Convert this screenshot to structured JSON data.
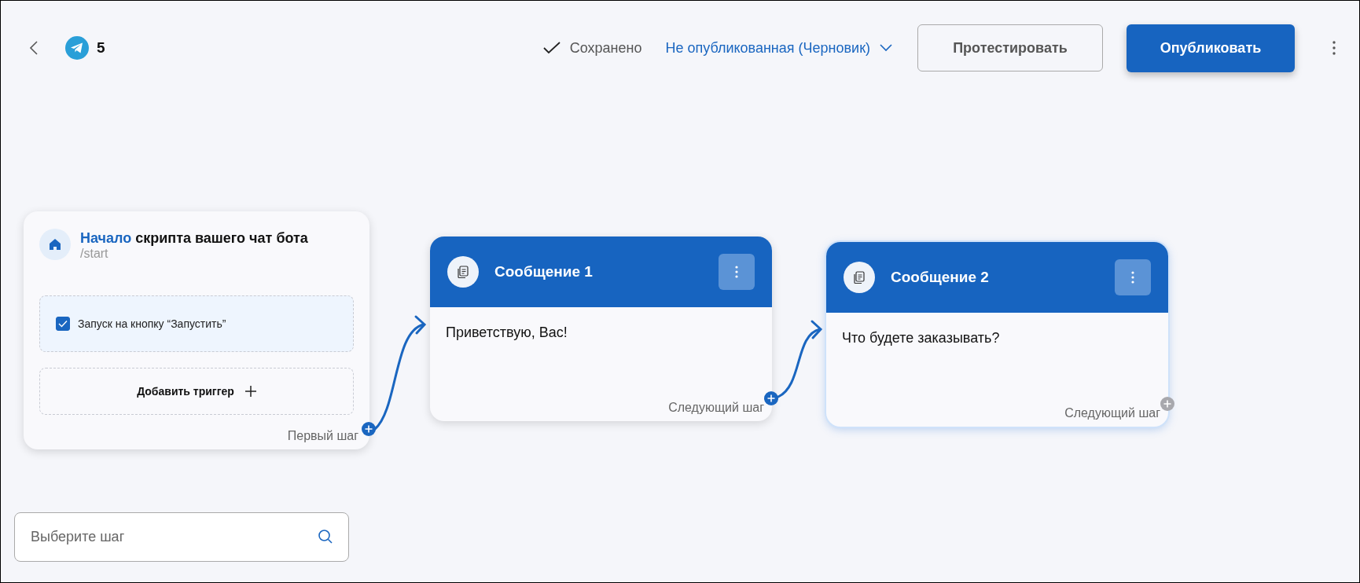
{
  "header": {
    "counter": "5",
    "save_status": "Сохранено",
    "publish_state": "Не опубликованная (Черновик)",
    "test_button": "Протестировать",
    "publish_button": "Опубликовать"
  },
  "start_node": {
    "title_accent": "Начало",
    "title_rest": "скрипта вашего чат бота",
    "command": "/start",
    "triggers": [
      {
        "label": "Запуск на кнопку “Запустить”",
        "checked": true
      }
    ],
    "add_trigger": "Добавить триггер",
    "footer": "Первый шаг",
    "connected": true
  },
  "steps": [
    {
      "title": "Сообщение 1",
      "text": "Приветствую, Вас!",
      "footer": "Следующий шаг",
      "selected": false,
      "connected": true
    },
    {
      "title": "Сообщение 2",
      "text": "Что будете заказывать?",
      "footer": "Следующий шаг",
      "selected": true,
      "connected": false
    }
  ],
  "step_search": {
    "placeholder": "Выберите шаг"
  }
}
